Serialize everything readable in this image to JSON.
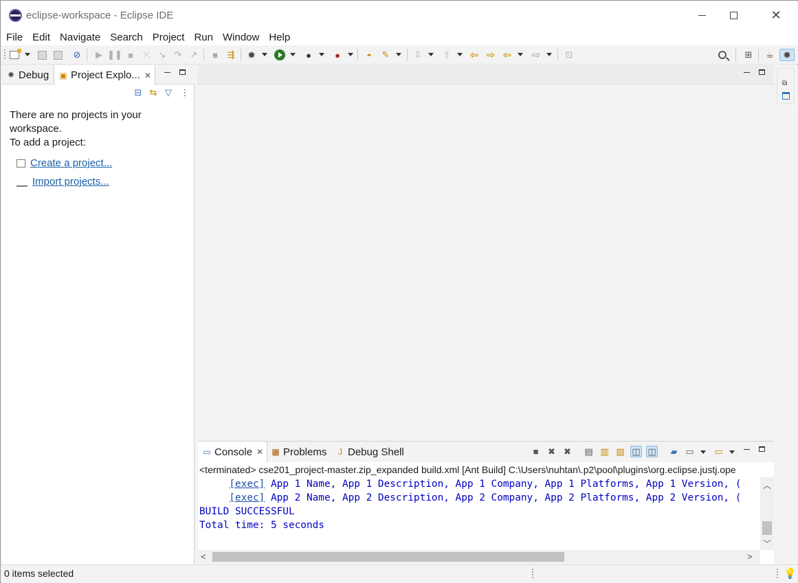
{
  "window": {
    "title": "eclipse-workspace - Eclipse IDE",
    "controls": {
      "minimize": "minimize",
      "maximize": "maximize",
      "close": "✕"
    }
  },
  "menu": [
    "File",
    "Edit",
    "Navigate",
    "Search",
    "Project",
    "Run",
    "Window",
    "Help"
  ],
  "toolbar": {
    "icons": [
      "new-icon",
      "save-icon",
      "save-all-icon",
      "skip-breakpoints-icon",
      "resume-icon",
      "suspend-icon",
      "terminate-icon",
      "disconnect-icon",
      "step-into-icon",
      "step-over-icon",
      "step-return-icon",
      "drop-to-frame-icon",
      "use-step-filters-icon",
      "debug-icon",
      "run-icon",
      "coverage-icon",
      "external-tools-icon",
      "open-type-icon",
      "search-tool-icon",
      "next-annotation-icon",
      "previous-annotation-icon",
      "last-edit-location-icon",
      "back-icon",
      "forward-icon",
      "pin-editor-icon",
      "search-icon",
      "open-perspective-icon",
      "java-perspective-icon",
      "debug-perspective-icon"
    ]
  },
  "left_panel": {
    "tabs": [
      {
        "label": "Debug",
        "icon": "debug-icon"
      },
      {
        "label": "Project Explo...",
        "icon": "project-explorer-icon",
        "active": true
      }
    ],
    "message": [
      "There are no projects in your",
      "workspace.",
      "To add a project:"
    ],
    "links": [
      {
        "label": "Create a project...",
        "icon": "new-project-icon"
      },
      {
        "label": "Import projects...",
        "icon": "import-icon"
      }
    ]
  },
  "console": {
    "tabs": [
      {
        "label": "Console",
        "icon": "console-icon",
        "active": true
      },
      {
        "label": "Problems",
        "icon": "problems-icon"
      },
      {
        "label": "Debug Shell",
        "icon": "debug-shell-icon"
      }
    ],
    "header": "<terminated> cse201_project-master.zip_expanded build.xml [Ant Build] C:\\Users\\nuhtan\\.p2\\pool\\plugins\\org.eclipse.justj.ope",
    "lines": [
      {
        "prefix": "     ",
        "link": "[exec]",
        "text": " App 1 Name, App 1 Description, App 1 Company, App 1 Platforms, App 1 Version, ("
      },
      {
        "prefix": "     ",
        "link": "[exec]",
        "text": " App 2 Name, App 2 Description, App 2 Company, App 2 Platforms, App 2 Version, ("
      },
      {
        "prefix": "",
        "link": "",
        "text": "BUILD SUCCESSFUL"
      },
      {
        "prefix": "",
        "link": "",
        "text": "Total time: 5 seconds"
      }
    ]
  },
  "status": {
    "text": "0 items selected",
    "icon": "lightbulb-icon"
  }
}
